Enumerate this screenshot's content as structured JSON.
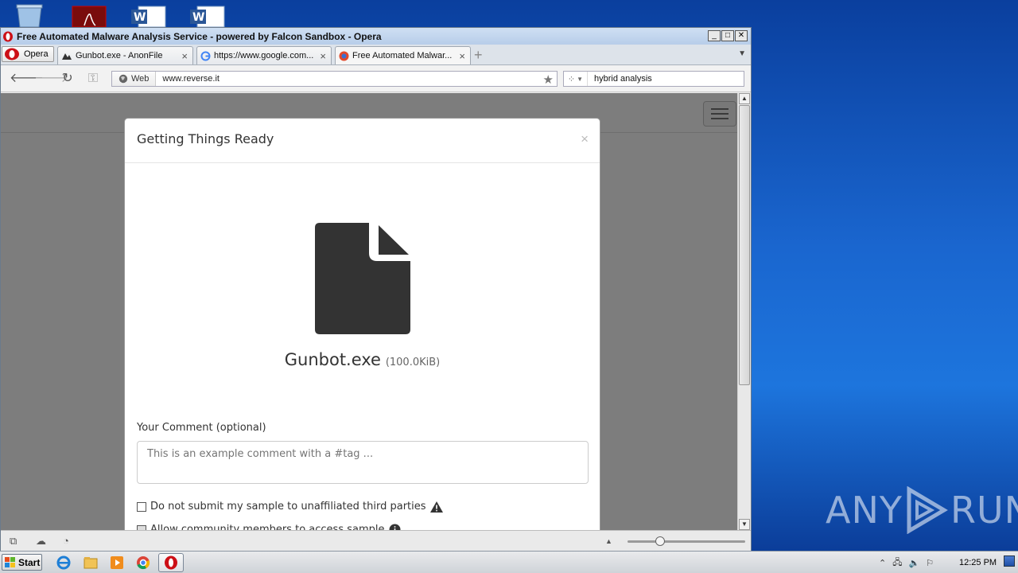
{
  "window": {
    "title": "Free Automated Malware Analysis Service - powered by Falcon Sandbox - Opera",
    "buttons": {
      "minimize": "_",
      "maximize": "□",
      "close": "✕"
    }
  },
  "tabs": {
    "menu_label": "Opera",
    "items": [
      {
        "label": "Gunbot.exe - AnonFile",
        "active": false
      },
      {
        "label": "https://www.google.com...",
        "active": false
      },
      {
        "label": "Free Automated Malwar...",
        "active": true
      }
    ]
  },
  "nav": {
    "web_label": "Web",
    "url": "www.reverse.it",
    "search_value": "hybrid analysis"
  },
  "modal": {
    "title": "Getting Things Ready",
    "close": "×",
    "file_name": "Gunbot.exe",
    "file_size": "(100.0KiB)",
    "comment_label": "Your Comment (optional)",
    "comment_placeholder": "This is an example comment with a #tag ...",
    "checkbox1": "Do not submit my sample to unaffiliated third parties",
    "checkbox2": "Allow community members to access sample"
  },
  "taskbar": {
    "start_label": "Start",
    "clock": "12:25 PM"
  },
  "watermark": {
    "left": "ANY",
    "right": "RUN"
  },
  "colors": {
    "opera_red": "#cc0f16",
    "file_icon": "#333333",
    "desktop_blue": "#1a66cf"
  }
}
